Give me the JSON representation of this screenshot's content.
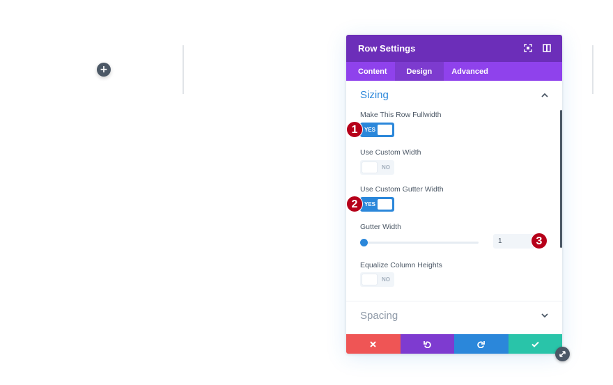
{
  "canvas": {
    "add_icon": "plus-icon",
    "add_symbol": "+"
  },
  "modal": {
    "title": "Row Settings",
    "header_icons": [
      "fullscreen-icon",
      "sidebar-toggle-icon"
    ],
    "tabs": [
      {
        "label": "Content",
        "active": false
      },
      {
        "label": "Design",
        "active": true
      },
      {
        "label": "Advanced",
        "active": false
      }
    ],
    "sections": {
      "sizing": {
        "title": "Sizing",
        "expanded": true,
        "fields": {
          "fullwidth": {
            "label": "Make This Row Fullwidth",
            "value": "YES"
          },
          "custom_width": {
            "label": "Use Custom Width",
            "value": "NO"
          },
          "custom_gutter": {
            "label": "Use Custom Gutter Width",
            "value": "YES"
          },
          "gutter_width": {
            "label": "Gutter Width",
            "value": "1",
            "slider_fraction": 0
          },
          "equalize_heights": {
            "label": "Equalize Column Heights",
            "value": "NO"
          }
        }
      },
      "spacing": {
        "title": "Spacing",
        "expanded": false
      }
    },
    "footer_buttons": [
      "close-icon",
      "undo-icon",
      "redo-icon",
      "check-icon"
    ]
  },
  "annotations": {
    "badge1": "1",
    "badge2": "2",
    "badge3": "3"
  },
  "colors": {
    "header": "#6c2eb9",
    "tabs": "#8f42ec",
    "active_tab": "#7d3bcf",
    "accent_blue": "#2b87da",
    "cancel": "#ef5555",
    "undo": "#7e3bd0",
    "redo": "#2b87da",
    "save": "#29c4a9",
    "badge": "#b6001a"
  }
}
